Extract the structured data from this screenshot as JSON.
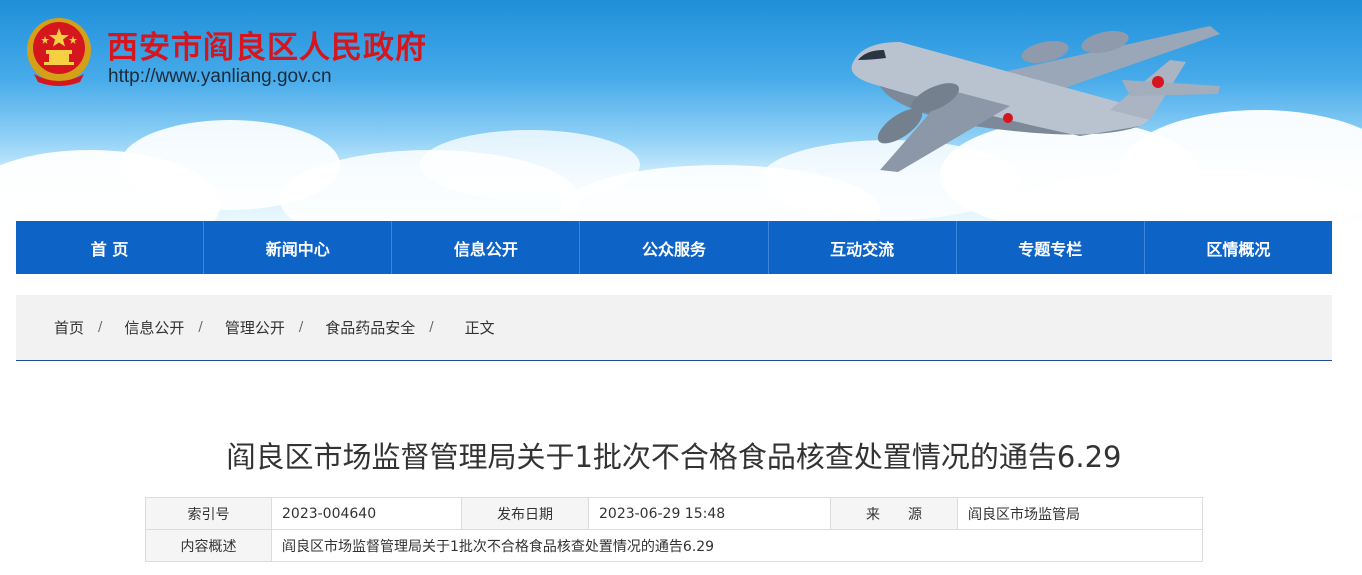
{
  "header": {
    "site_title": "西安市阎良区人民政府",
    "site_url": "http://www.yanliang.gov.cn"
  },
  "nav": {
    "items": [
      {
        "label": "首 页"
      },
      {
        "label": "新闻中心"
      },
      {
        "label": "信息公开"
      },
      {
        "label": "公众服务"
      },
      {
        "label": "互动交流"
      },
      {
        "label": "专题专栏"
      },
      {
        "label": "区情概况"
      }
    ]
  },
  "breadcrumb": {
    "items": [
      "首页",
      "信息公开",
      "管理公开",
      "食品药品安全"
    ],
    "separator": "/",
    "current": "正文"
  },
  "article": {
    "title": "阎良区市场监督管理局关于1批次不合格食品核查处置情况的通告6.29",
    "meta": {
      "index_label": "索引号",
      "index_value": "2023-004640",
      "date_label": "发布日期",
      "date_value": "2023-06-29 15:48",
      "source_label": "来　　源",
      "source_value": "阎良区市场监管局",
      "summary_label": "内容概述",
      "summary_value": "阎良区市场监督管理局关于1批次不合格食品核查处置情况的通告6.29"
    }
  },
  "colors": {
    "nav_bg": "#0e63c7",
    "title_red": "#d6161e",
    "crumb_bg": "#f2f2f2"
  },
  "icons": {
    "emblem": "national-emblem-icon",
    "banner": "transport-plane-illustration"
  }
}
